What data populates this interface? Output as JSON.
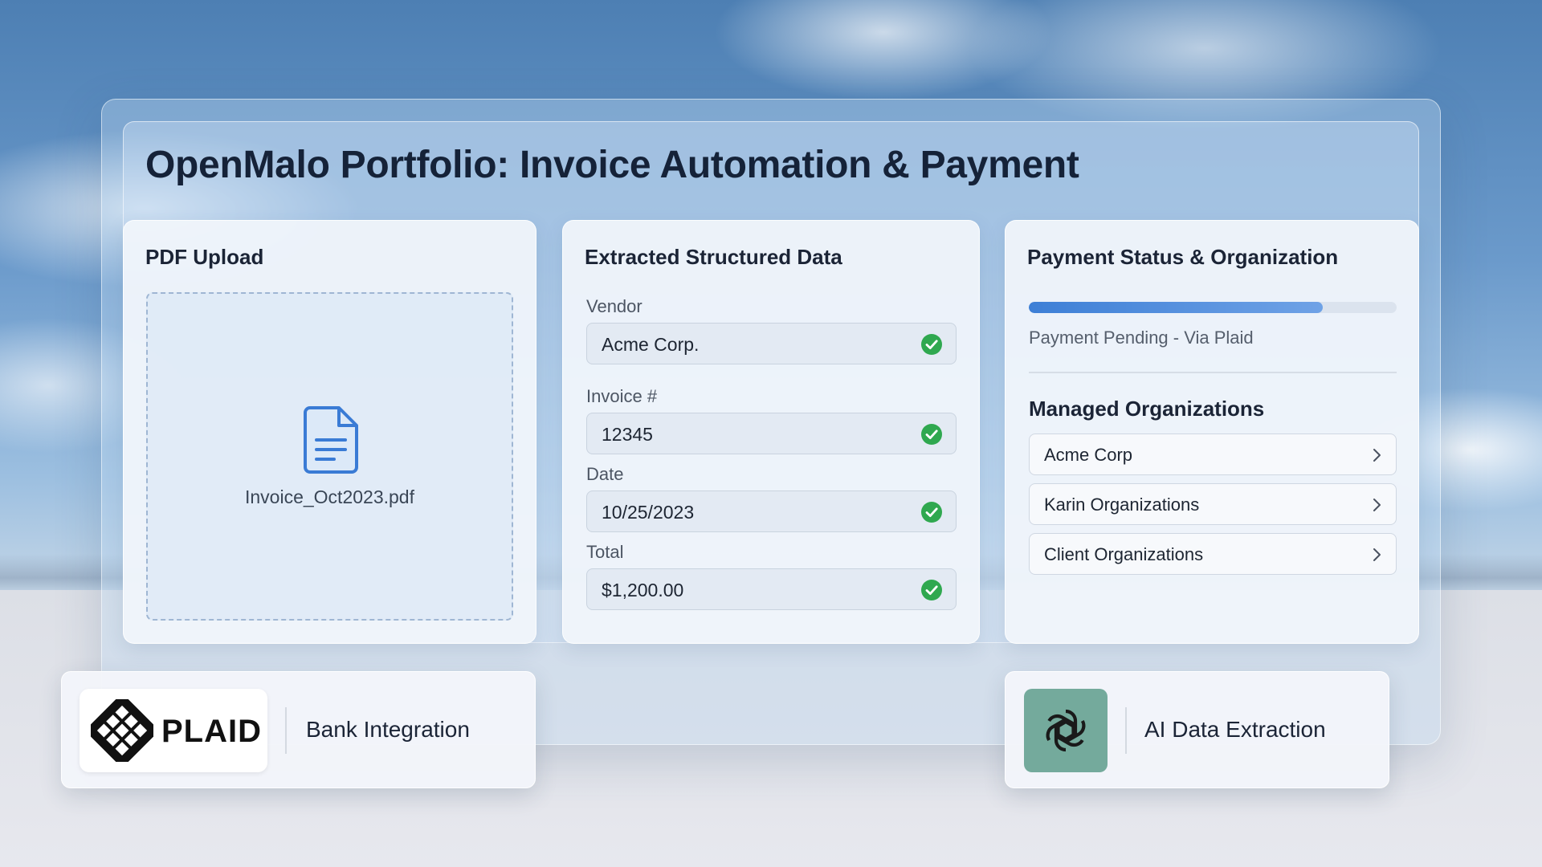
{
  "page": {
    "title": "OpenMalo Portfolio: Invoice Automation & Payment"
  },
  "upload": {
    "title": "PDF Upload",
    "file_name": "Invoice_Oct2023.pdf",
    "file_icon": "document-icon"
  },
  "extracted": {
    "title": "Extracted Structured Data",
    "fields": [
      {
        "label": "Vendor",
        "value": "Acme Corp.",
        "status_icon": "check-circle-icon"
      },
      {
        "label": "Invoice #",
        "value": "12345",
        "status_icon": "check-circle-icon"
      },
      {
        "label": "Date",
        "value": "10/25/2023",
        "status_icon": "check-circle-icon"
      },
      {
        "label": "Total",
        "value": "$1,200.00",
        "status_icon": "check-circle-icon"
      }
    ]
  },
  "payment": {
    "title": "Payment Status & Organization",
    "progress_fraction": 0.8,
    "status_text": "Payment Pending - Via Plaid",
    "orgs_heading": "Managed Organizations",
    "organizations": [
      {
        "label": "Acme Corp"
      },
      {
        "label": "Karin Organizations"
      },
      {
        "label": "Client Organizations"
      }
    ]
  },
  "integrations": {
    "plaid": {
      "logo_text": "PLAID",
      "label": "Bank Integration"
    },
    "ai": {
      "label": "AI Data Extraction",
      "logo_icon": "openai-icon"
    }
  },
  "colors": {
    "check_green": "#2fa84f",
    "progress_blue": "#3d7fd6",
    "ai_logo_bg": "#74aa9c",
    "title_text": "#152238"
  }
}
